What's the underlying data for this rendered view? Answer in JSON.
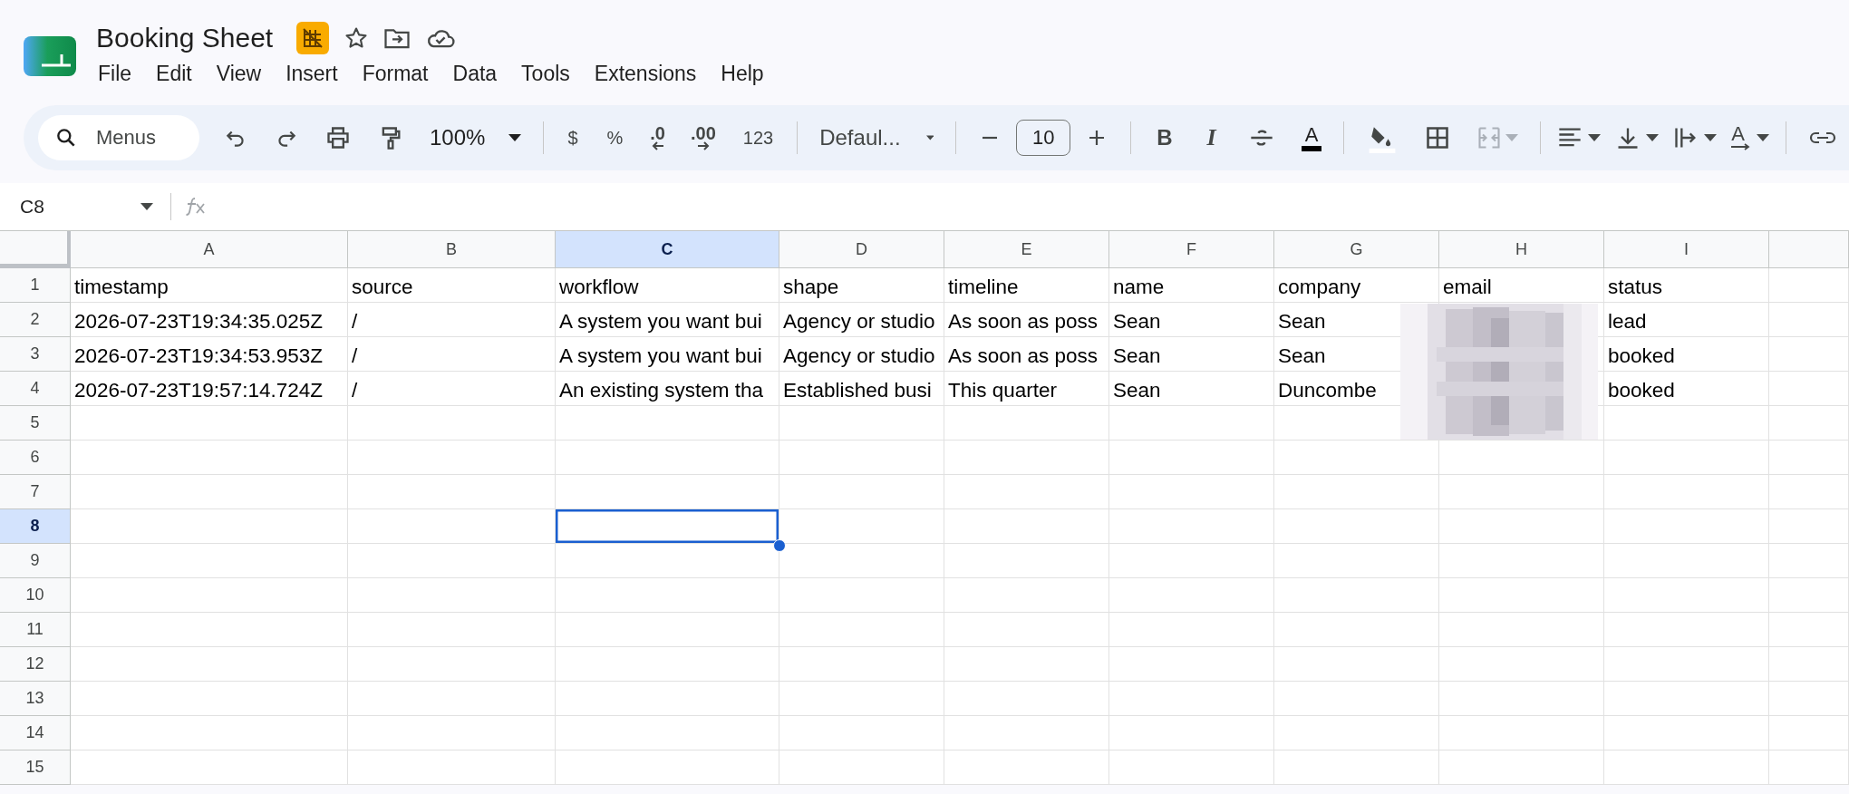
{
  "document": {
    "title": "Booking Sheet"
  },
  "menu": [
    "File",
    "Edit",
    "View",
    "Insert",
    "Format",
    "Data",
    "Tools",
    "Extensions",
    "Help"
  ],
  "toolbar": {
    "menus_search": {
      "placeholder": "Menus"
    },
    "zoom": "100%",
    "currency": "$",
    "percent": "%",
    "decrease_decimals": ".0",
    "increase_decimals": ".00",
    "more_formats": "123",
    "font": "Defaul...",
    "font_size": "10",
    "bold": "B",
    "italic": "I",
    "text_color": "A",
    "text_rotation": "A",
    "merge_cells": {
      "disabled": true
    }
  },
  "formula_bar": {
    "cell_reference": "C8"
  },
  "columns": [
    {
      "letter": "A",
      "selected": false
    },
    {
      "letter": "B",
      "selected": false
    },
    {
      "letter": "C",
      "selected": true
    },
    {
      "letter": "D",
      "selected": false
    },
    {
      "letter": "E",
      "selected": false
    },
    {
      "letter": "F",
      "selected": false
    },
    {
      "letter": "G",
      "selected": false
    },
    {
      "letter": "H",
      "selected": false
    },
    {
      "letter": "I",
      "selected": false
    }
  ],
  "rows": [
    {
      "number": "1",
      "selected": false,
      "cells": [
        "timestamp",
        "source",
        "workflow",
        "shape",
        "timeline",
        "name",
        "company",
        "email",
        "status"
      ]
    },
    {
      "number": "2",
      "selected": false,
      "cells": [
        "2026-07-23T19:34:35.025Z",
        "/",
        "A system you want bui",
        "Agency or studio",
        "As soon as poss",
        "Sean",
        "Sean",
        null,
        "lead"
      ]
    },
    {
      "number": "3",
      "selected": false,
      "cells": [
        "2026-07-23T19:34:53.953Z",
        "/",
        "A system you want bui",
        "Agency or studio",
        "As soon as poss",
        "Sean",
        "Sean",
        null,
        "booked"
      ]
    },
    {
      "number": "4",
      "selected": false,
      "cells": [
        "2026-07-23T19:57:14.724Z",
        "/",
        "An existing system tha",
        "Established busi",
        "This quarter",
        "Sean",
        "Duncombe",
        null,
        "booked"
      ]
    },
    {
      "number": "5",
      "selected": false,
      "cells": []
    },
    {
      "number": "6",
      "selected": false,
      "cells": []
    },
    {
      "number": "7",
      "selected": false,
      "cells": []
    },
    {
      "number": "8",
      "selected": true,
      "cells": []
    },
    {
      "number": "9",
      "selected": false,
      "cells": []
    },
    {
      "number": "10",
      "selected": false,
      "cells": []
    },
    {
      "number": "11",
      "selected": false,
      "cells": []
    },
    {
      "number": "12",
      "selected": false,
      "cells": []
    },
    {
      "number": "13",
      "selected": false,
      "cells": []
    },
    {
      "number": "14",
      "selected": false,
      "cells": []
    },
    {
      "number": "15",
      "selected": false,
      "cells": []
    }
  ]
}
